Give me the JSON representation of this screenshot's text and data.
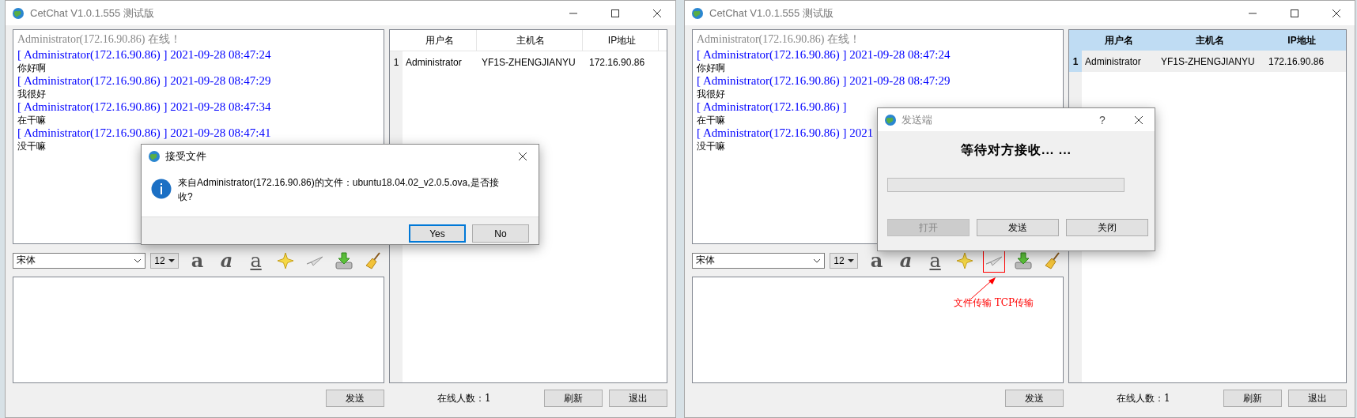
{
  "windows": [
    {
      "title": "CetChat V1.0.1.555 测试版",
      "chat": [
        {
          "kind": "status",
          "text": "Administrator(172.16.90.86) 在线！"
        },
        {
          "kind": "header",
          "text": "[ Administrator(172.16.90.86) ] 2021-09-28 08:47:24"
        },
        {
          "kind": "message",
          "text": "你好啊"
        },
        {
          "kind": "header",
          "text": "[ Administrator(172.16.90.86) ] 2021-09-28 08:47:29"
        },
        {
          "kind": "message",
          "text": "我很好"
        },
        {
          "kind": "header",
          "text": "[ Administrator(172.16.90.86) ] 2021-09-28 08:47:34"
        },
        {
          "kind": "message",
          "text": "在干嘛"
        },
        {
          "kind": "header",
          "text": "[ Administrator(172.16.90.86) ] 2021-09-28 08:47:41"
        },
        {
          "kind": "message",
          "text": "没干嘛"
        }
      ],
      "font": "宋体",
      "size": "12",
      "toolbar": [
        {
          "kind": "bold",
          "glyph": "a",
          "highlighted": false
        },
        {
          "kind": "italic",
          "glyph": "a",
          "highlighted": false
        },
        {
          "kind": "underline",
          "glyph": "a",
          "highlighted": false
        },
        {
          "kind": "star",
          "highlighted": false
        },
        {
          "kind": "plane",
          "highlighted": false
        },
        {
          "kind": "download",
          "highlighted": false
        },
        {
          "kind": "broom",
          "highlighted": false
        }
      ],
      "send_button": "发送",
      "online_count": "在线人数：1",
      "refresh_button": "刷新",
      "exit_button": "退出",
      "users": {
        "focused": false,
        "columns": [
          "用户名",
          "主机名",
          "IP地址"
        ],
        "rows": [
          {
            "index": "1",
            "cells": [
              "Administrator",
              "YF1S-ZHENGJIANYU",
              "172.16.90.86"
            ],
            "selected": false
          }
        ]
      },
      "dialog": {
        "kind": "confirm",
        "title": "接受文件",
        "message": "来自Administrator(172.16.90.86)的文件：ubuntu18.04.02_v2.0.5.ova,是否接收?",
        "buttons": [
          {
            "label": "Yes",
            "default": true
          },
          {
            "label": "No",
            "default": false
          }
        ]
      }
    },
    {
      "title": "CetChat V1.0.1.555 测试版",
      "chat": [
        {
          "kind": "status",
          "text": "Administrator(172.16.90.86) 在线！"
        },
        {
          "kind": "header",
          "text": "[ Administrator(172.16.90.86) ] 2021-09-28 08:47:24"
        },
        {
          "kind": "message",
          "text": "你好啊"
        },
        {
          "kind": "header",
          "text": "[ Administrator(172.16.90.86) ] 2021-09-28 08:47:29"
        },
        {
          "kind": "message",
          "text": "我很好"
        },
        {
          "kind": "header",
          "text": "[ Administrator(172.16.90.86) ]"
        },
        {
          "kind": "message",
          "text": "在干嘛"
        },
        {
          "kind": "header",
          "text": "[ Administrator(172.16.90.86) ] 2021"
        },
        {
          "kind": "message",
          "text": "没干嘛"
        }
      ],
      "font": "宋体",
      "size": "12",
      "toolbar": [
        {
          "kind": "bold",
          "glyph": "a",
          "highlighted": false
        },
        {
          "kind": "italic",
          "glyph": "a",
          "highlighted": false
        },
        {
          "kind": "underline",
          "glyph": "a",
          "highlighted": false
        },
        {
          "kind": "star",
          "highlighted": false
        },
        {
          "kind": "plane",
          "highlighted": true
        },
        {
          "kind": "download",
          "highlighted": false
        },
        {
          "kind": "broom",
          "highlighted": false
        }
      ],
      "annotation": {
        "text": "文件传输 TCP传输"
      },
      "send_button": "发送",
      "online_count": "在线人数：1",
      "refresh_button": "刷新",
      "exit_button": "退出",
      "users": {
        "focused": true,
        "columns": [
          "用户名",
          "主机名",
          "IP地址"
        ],
        "rows": [
          {
            "index": "1",
            "cells": [
              "Administrator",
              "YF1S-ZHENGJIANYU",
              "172.16.90.86"
            ],
            "selected": true
          }
        ]
      },
      "dialog": {
        "kind": "progress",
        "title": "发送端",
        "help": "?",
        "heading": "等待对方接收... ...",
        "level": 0,
        "buttons": [
          {
            "label": "打开",
            "disabled": true
          },
          {
            "label": "发送",
            "disabled": false
          },
          {
            "label": "关闭",
            "disabled": false
          }
        ]
      }
    }
  ]
}
